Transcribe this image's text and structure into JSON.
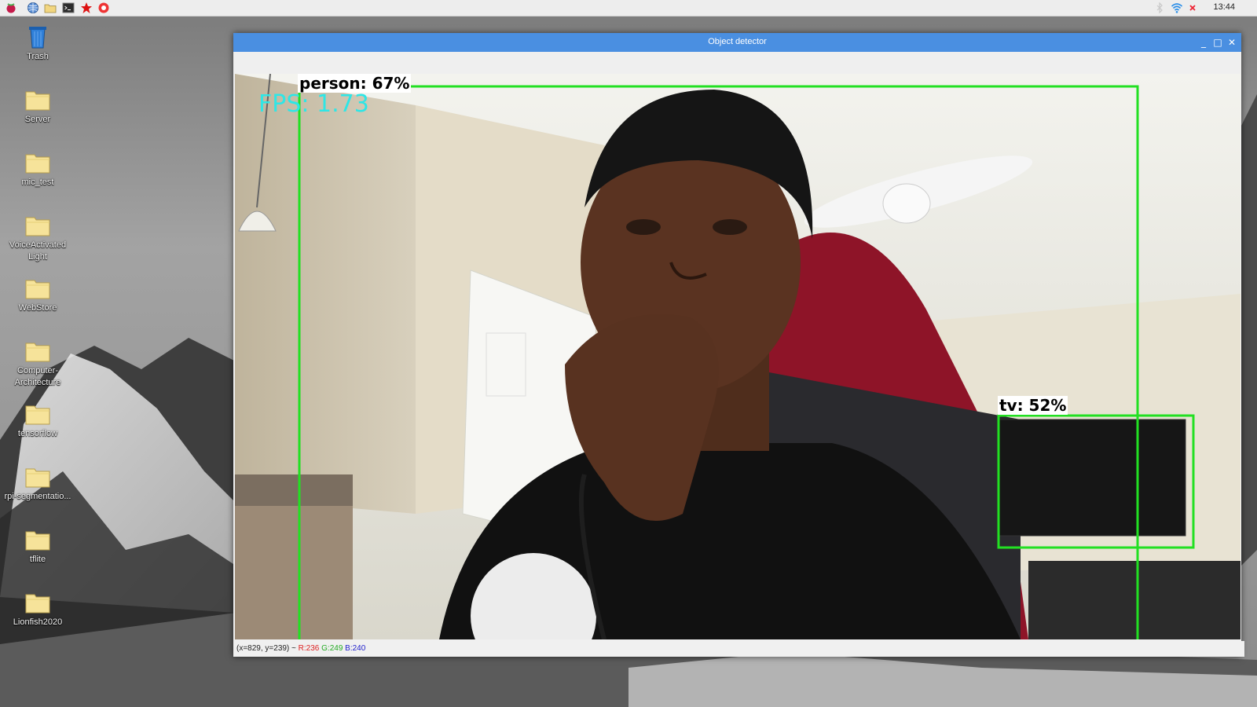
{
  "taskbar": {
    "clock": "13:44",
    "launchers": [
      "raspberry-menu-icon",
      "web-browser-icon",
      "file-manager-icon",
      "terminal-icon",
      "mathematica-icon",
      "wolfram-icon"
    ],
    "tray": [
      "bluetooth-icon",
      "wifi-icon",
      "volume-muted-icon"
    ]
  },
  "desktop": {
    "items": [
      {
        "label": "Trash",
        "icon": "trash-icon"
      },
      {
        "label": "Server",
        "icon": "folder-icon"
      },
      {
        "label": "mic_test",
        "icon": "folder-icon"
      },
      {
        "label": "VoiceActivated Light",
        "icon": "folder-icon"
      },
      {
        "label": "WebStore",
        "icon": "folder-icon"
      },
      {
        "label": "Computer-Architecture",
        "icon": "folder-icon"
      },
      {
        "label": "tensorflow",
        "icon": "folder-icon"
      },
      {
        "label": "rpi-segmentatio...",
        "icon": "folder-icon"
      },
      {
        "label": "tflite",
        "icon": "folder-icon"
      },
      {
        "label": "Lionfish2020",
        "icon": "folder-icon"
      }
    ]
  },
  "window": {
    "title": "Object detector",
    "controls": {
      "minimize": "_",
      "maximize": "□",
      "close": "✕"
    },
    "fps_text": "FPS: 1.73",
    "detections": [
      {
        "label": "person: 67%",
        "class": "person",
        "score": 0.67,
        "color": "#22e022"
      },
      {
        "label": "tv: 52%",
        "class": "tv",
        "score": 0.52,
        "color": "#22e022"
      }
    ],
    "status": {
      "coords": "(x=829, y=239) ~",
      "r": "R:236",
      "g": "G:249",
      "b": "B:240"
    }
  },
  "colors": {
    "titlebar": "#4a8fe1",
    "box": "#22e022",
    "fps": "#2ee6e6"
  }
}
